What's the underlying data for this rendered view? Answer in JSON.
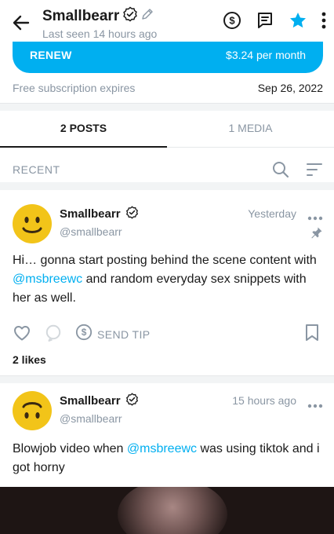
{
  "header": {
    "title": "Smallbearr",
    "subtitle": "Last seen 14 hours ago",
    "icons": [
      "back-arrow-icon",
      "verified-icon",
      "pencil-icon",
      "dollar-icon",
      "message-icon",
      "star-icon",
      "more-icon"
    ]
  },
  "subscription": {
    "renew_label": "RENEW",
    "price": "$3.24 per month",
    "expires_label": "Free subscription expires",
    "expires_date": "Sep 26, 2022"
  },
  "tabs": [
    {
      "label": "2 POSTS",
      "active": true
    },
    {
      "label": "1 MEDIA",
      "active": false
    }
  ],
  "feed": {
    "section_label": "RECENT"
  },
  "posts": [
    {
      "name": "Smallbearr",
      "handle": "@smallbearr",
      "time": "Yesterday",
      "text_before": "Hi… gonna start posting behind the scene content with ",
      "mention": "@msbreewc",
      "text_after": " and random everyday sex snippets with her as well.",
      "pinned": true,
      "send_tip_label": "SEND TIP",
      "likes": "2 likes"
    },
    {
      "name": "Smallbearr",
      "handle": "@smallbearr",
      "time": "15 hours ago",
      "text_before": "Blowjob video when ",
      "mention": "@msbreewc",
      "text_after": " was using tiktok and i got horny"
    }
  ],
  "colors": {
    "accent": "#00aff0",
    "muted": "#8a96a3",
    "text": "#1a1a1a",
    "avatar": "#f2c419"
  }
}
